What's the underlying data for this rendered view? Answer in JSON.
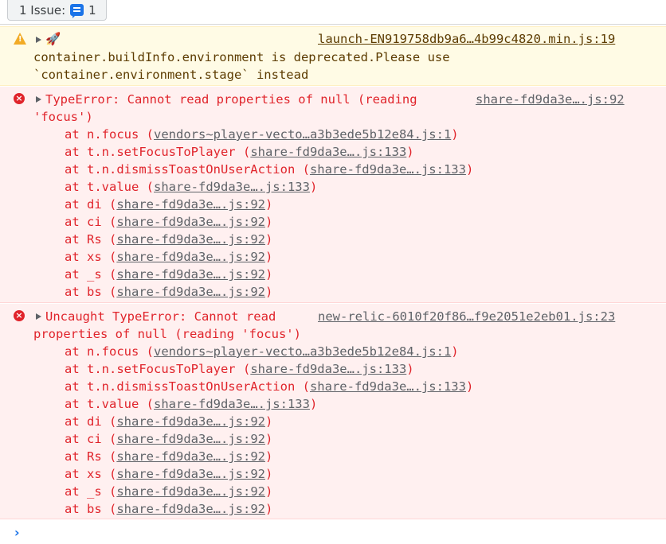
{
  "issues": {
    "label": "1 Issue:",
    "count": "1"
  },
  "warning": {
    "emoji": "🚀",
    "source": "launch-EN919758db9a6…4b99c4820.min.js:19",
    "lines": [
      "container.buildInfo.environment is deprecated.Please use",
      "`container.environment.stage` instead"
    ]
  },
  "error1": {
    "title": "TypeError: Cannot read properties of null (reading",
    "title_cont": "'focus')",
    "source": "share-fd9da3e….js:92",
    "stack": [
      {
        "fn": "n.focus",
        "link": "vendors~player-vecto…a3b3ede5b12e84.js:1"
      },
      {
        "fn": "t.n.setFocusToPlayer",
        "link": "share-fd9da3e….js:133"
      },
      {
        "fn": "t.n.dismissToastOnUserAction",
        "link": "share-fd9da3e….js:133"
      },
      {
        "fn": "t.value",
        "link": "share-fd9da3e….js:133"
      },
      {
        "fn": "di",
        "link": "share-fd9da3e….js:92"
      },
      {
        "fn": "ci",
        "link": "share-fd9da3e….js:92"
      },
      {
        "fn": "Rs",
        "link": "share-fd9da3e….js:92"
      },
      {
        "fn": "xs",
        "link": "share-fd9da3e….js:92"
      },
      {
        "fn": "_s",
        "link": "share-fd9da3e….js:92"
      },
      {
        "fn": "bs",
        "link": "share-fd9da3e….js:92"
      }
    ]
  },
  "error2": {
    "title": "Uncaught TypeError: Cannot read",
    "title_cont": "properties of null (reading 'focus')",
    "source": "new-relic-6010f20f86…f9e2051e2eb01.js:23",
    "stack": [
      {
        "fn": "n.focus",
        "link": "vendors~player-vecto…a3b3ede5b12e84.js:1"
      },
      {
        "fn": "t.n.setFocusToPlayer",
        "link": "share-fd9da3e….js:133"
      },
      {
        "fn": "t.n.dismissToastOnUserAction",
        "link": "share-fd9da3e….js:133"
      },
      {
        "fn": "t.value",
        "link": "share-fd9da3e….js:133"
      },
      {
        "fn": "di",
        "link": "share-fd9da3e….js:92"
      },
      {
        "fn": "ci",
        "link": "share-fd9da3e….js:92"
      },
      {
        "fn": "Rs",
        "link": "share-fd9da3e….js:92"
      },
      {
        "fn": "xs",
        "link": "share-fd9da3e….js:92"
      },
      {
        "fn": "_s",
        "link": "share-fd9da3e….js:92"
      },
      {
        "fn": "bs",
        "link": "share-fd9da3e….js:92"
      }
    ]
  },
  "prompt": {
    "symbol": "›"
  },
  "colors": {
    "error_text": "#e0242b",
    "error_bg": "#fff0f0",
    "warning_bg": "#fffbe5",
    "warning_text": "#5c3b00",
    "link": "#5f6368",
    "issue_accent": "#1a73e8"
  },
  "icons": {
    "warning": "warning-triangle-icon",
    "error": "error-circle-icon",
    "issue": "message-icon",
    "expand": "expand-triangle-icon",
    "prompt": "chevron-right-icon"
  }
}
